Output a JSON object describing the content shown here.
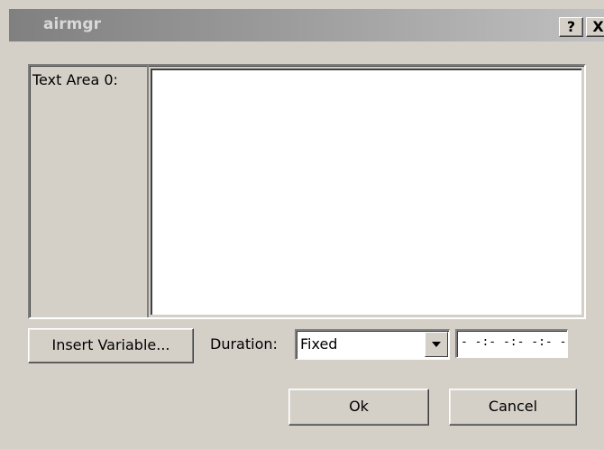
{
  "window": {
    "title": "airmgr",
    "help_label": "?",
    "close_label": "X"
  },
  "text_area": {
    "label": "Text Area 0:",
    "value": ""
  },
  "controls": {
    "insert_variable_label": "Insert Variable...",
    "duration_label": "Duration:",
    "duration_value": "Fixed",
    "time_value": "- -:- -:- -:- -"
  },
  "buttons": {
    "ok_label": "Ok",
    "cancel_label": "Cancel"
  },
  "colors": {
    "dialog_background": "#d4d0c8",
    "title_gradient_start": "#808080",
    "title_gradient_end": "#c0c0c0"
  }
}
